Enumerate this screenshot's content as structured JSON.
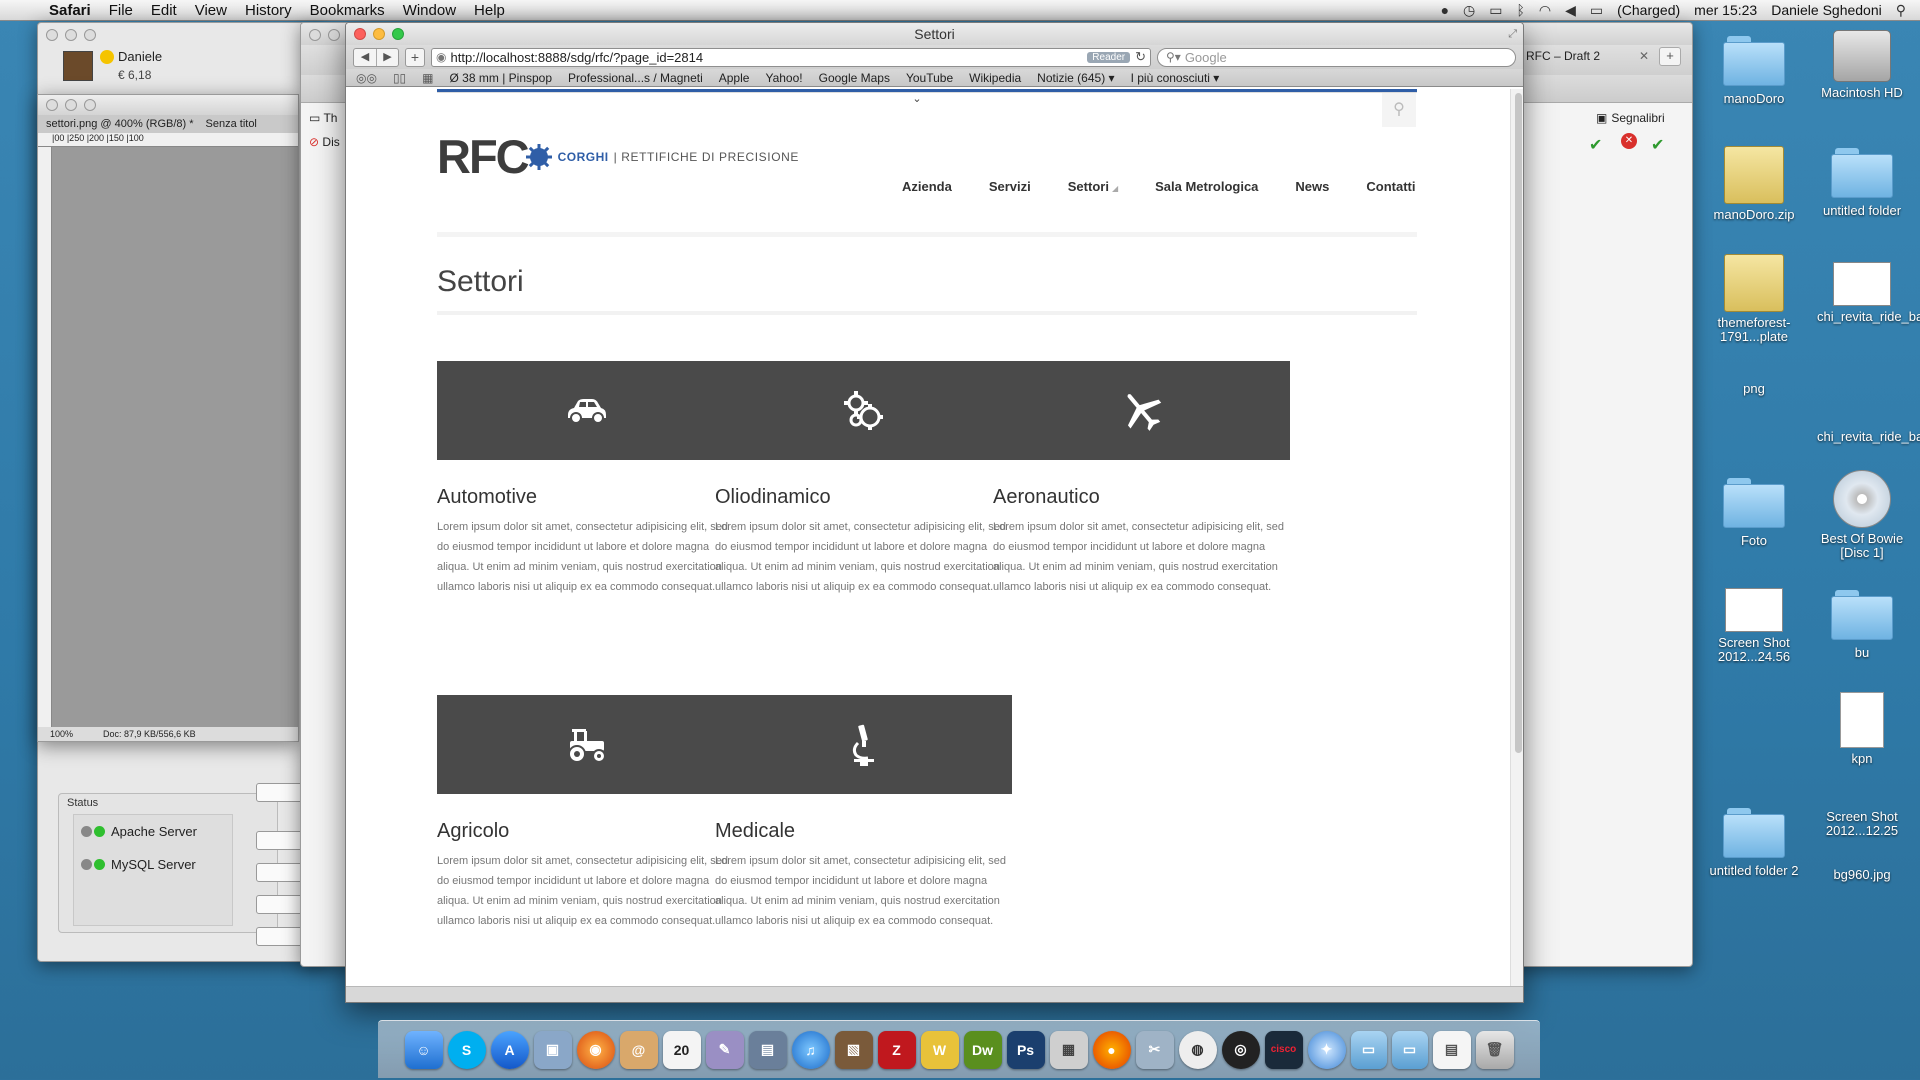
{
  "menubar": {
    "app": "Safari",
    "items": [
      "File",
      "Edit",
      "View",
      "History",
      "Bookmarks",
      "Window",
      "Help"
    ],
    "battery": "(Charged)",
    "clock": "mer 15:23",
    "user": "Daniele Sghedoni"
  },
  "skype": {
    "user": "Daniele",
    "credit": "€ 6,18"
  },
  "photoshop": {
    "tab1": "settori.png @ 400% (RGB/8) *",
    "tab2": "Senza titol",
    "ruler": "|00     |250    |200    |150    |100",
    "zoom": "100%",
    "doc": "Doc: 87,9 KB/556,6 KB"
  },
  "mamp": {
    "status_label": "Status",
    "servers": [
      "Apache Server",
      "MySQL Server"
    ]
  },
  "back_window": {
    "bookmark_label": "Segnalibri",
    "tab_label": "RFC – Draft 2",
    "fav1": "Th",
    "fav2": "Dis"
  },
  "safari": {
    "title": "Settori",
    "url": "http://localhost:8888/sdg/rfc/?page_id=2814",
    "reader": "Reader",
    "search_placeholder": "Google",
    "bookmarks": [
      "Ø 38 mm | Pinspop",
      "Professional...s / Magneti",
      "Apple",
      "Yahoo!",
      "Google Maps",
      "YouTube",
      "Wikipedia",
      "Notizie (645) ▾",
      "I più conosciuti ▾"
    ]
  },
  "site": {
    "logo_rfc": "RFC",
    "logo_brand": "CORGHI",
    "logo_tagline": "| RETTIFICHE DI PRECISIONE",
    "nav": [
      "Azienda",
      "Servizi",
      "Settori",
      "Sala Metrologica",
      "News",
      "Contatti"
    ],
    "page_title": "Settori",
    "cards": [
      {
        "title": "Automotive",
        "icon": "car-icon",
        "text": "Lorem ipsum dolor sit amet, consectetur adipisicing elit, sed do eiusmod tempor incididunt ut labore et dolore magna aliqua. Ut enim ad minim veniam, quis nostrud exercitation ullamco laboris nisi ut aliquip ex ea commodo consequat."
      },
      {
        "title": "Oliodinamico",
        "icon": "gears-icon",
        "text": "Lorem ipsum dolor sit amet, consectetur adipisicing elit, sed do eiusmod tempor incididunt ut labore et dolore magna aliqua. Ut enim ad minim veniam, quis nostrud exercitation ullamco laboris nisi ut aliquip ex ea commodo consequat."
      },
      {
        "title": "Aeronautico",
        "icon": "airplane-icon",
        "text": "Lorem ipsum dolor sit amet, consectetur adipisicing elit, sed do eiusmod tempor incididunt ut labore et dolore magna aliqua. Ut enim ad minim veniam, quis nostrud exercitation ullamco laboris nisi ut aliquip ex ea commodo consequat."
      },
      {
        "title": "Agricolo",
        "icon": "tractor-icon",
        "text": "Lorem ipsum dolor sit amet, consectetur adipisicing elit, sed do eiusmod tempor incididunt ut labore et dolore magna aliqua. Ut enim ad minim veniam, quis nostrud exercitation ullamco laboris nisi ut aliquip ex ea commodo consequat."
      },
      {
        "title": "Medicale",
        "icon": "microscope-icon",
        "text": "Lorem ipsum dolor sit amet, consectetur adipisicing elit, sed do eiusmod tempor incididunt ut labore et dolore magna aliqua. Ut enim ad minim veniam, quis nostrud exercitation ullamco laboris nisi ut aliquip ex ea commodo consequat."
      }
    ]
  },
  "desktop": {
    "icons": [
      {
        "label": "manoDoro",
        "kind": "folder"
      },
      {
        "label": "Macintosh HD",
        "kind": "drive"
      },
      {
        "label": "manoDoro.zip",
        "kind": "archive"
      },
      {
        "label": "untitled folder",
        "kind": "folder"
      },
      {
        "label": "themeforest-1791...plate",
        "kind": "archive"
      },
      {
        "label": "chi_revita_ride_banner.jpg",
        "kind": "image"
      },
      {
        "label": "png",
        "kind": "folder"
      },
      {
        "label": "chi_revita_ride_banner.png",
        "kind": "image"
      },
      {
        "label": "Foto",
        "kind": "folder"
      },
      {
        "label": "Best Of Bowie [Disc 1]",
        "kind": "disc"
      },
      {
        "label": "Screen Shot 2012...24.56",
        "kind": "image"
      },
      {
        "label": "bu",
        "kind": "folder"
      },
      {
        "label": "kpn",
        "kind": "document"
      },
      {
        "label": "untitled folder 2",
        "kind": "folder"
      },
      {
        "label": "Screen Shot 2012...12.25",
        "kind": "image"
      },
      {
        "label": "bg960.jpg",
        "kind": "image"
      }
    ]
  },
  "colors": {
    "brand_blue": "#2f5ea7",
    "card_bg": "#4a4a4a",
    "desktop": "#3a86b4"
  }
}
